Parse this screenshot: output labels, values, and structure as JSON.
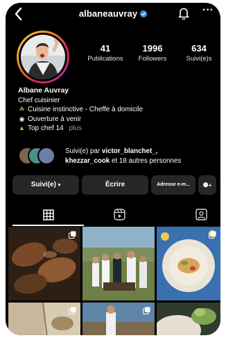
{
  "profile": {
    "username": "albaneauvray",
    "display_name": "Albane Auvray",
    "category": "Chef cuisinier",
    "bio_lines": [
      {
        "icon": "seedling-icon",
        "text": "Cuisine instinctive - Cheffe à domicile"
      },
      {
        "icon": "eyes-icon",
        "text": "Ouverture à venir"
      },
      {
        "icon": "trophy-icon",
        "text": "Top chef 14"
      }
    ],
    "more_label": "plus"
  },
  "stats": [
    {
      "value": "41",
      "label": "Publications"
    },
    {
      "value": "1996",
      "label": "Followers"
    },
    {
      "value": "634",
      "label": "Suivi(e)s"
    }
  ],
  "followed_by": {
    "prefix": "Suivi(e) par",
    "first": "victor_blanchet_,",
    "second": "khezzar_cook",
    "suffix": "et 18 autres personnes"
  },
  "actions": {
    "follow_label": "Suivi(e)",
    "message_label": "Écrire",
    "email_label": "Adresse e-m...",
    "suggest_label": "+"
  },
  "tabs": [
    "grid-icon",
    "reels-icon",
    "tagged-icon"
  ],
  "colors": {
    "background": "#000000",
    "button": "#262626",
    "verified": "#3897f0",
    "ring_start": "#f6d34a",
    "ring_end": "#a533b0"
  }
}
